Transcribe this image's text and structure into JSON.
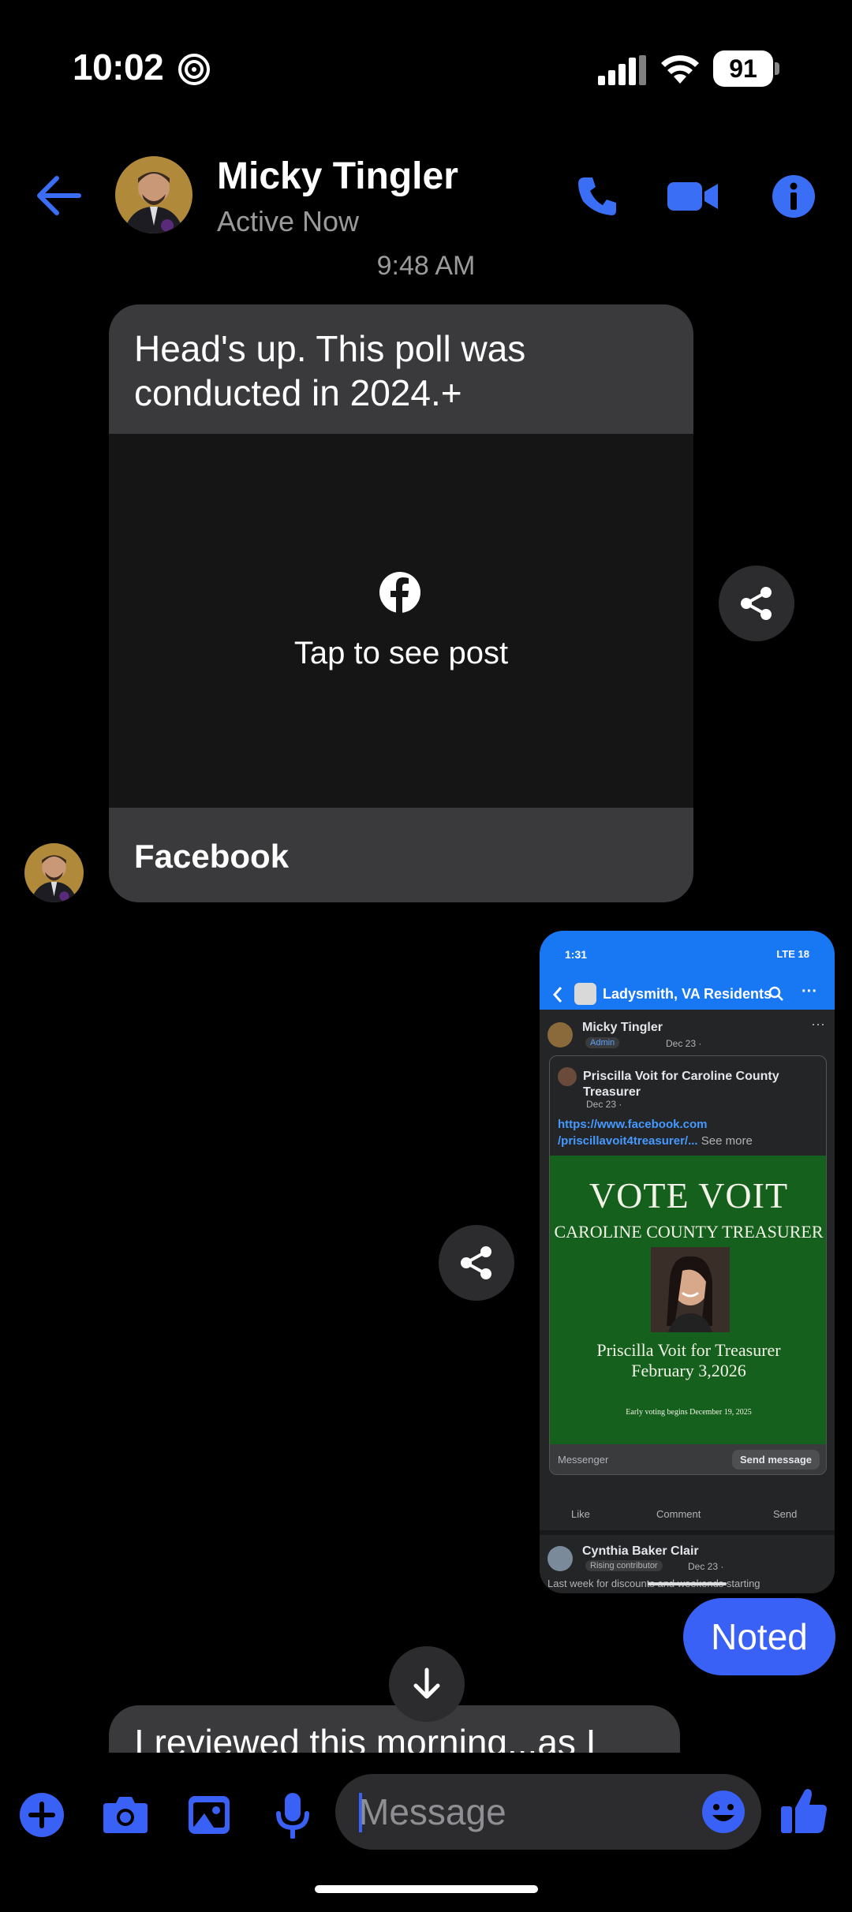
{
  "status_bar": {
    "time": "10:02",
    "battery": "91"
  },
  "header": {
    "contact_name": "Micky Tingler",
    "contact_status": "Active Now"
  },
  "conversation": {
    "timestamp": "9:48 AM",
    "shared_post": {
      "message": "Head's up.  This poll was conducted in 2024.+",
      "preview_label": "Tap to see post",
      "source": "Facebook"
    },
    "attachment": {
      "status_time": "1:31",
      "status_right": "LTE 18",
      "group_name": "Ladysmith, VA Residents",
      "poster_name": "Micky Tingler",
      "poster_badge": "Admin",
      "poster_date": "Dec 23 ·",
      "shared_page": "Priscilla Voit for Caroline County Treasurer",
      "shared_date": "Dec 23 ·",
      "link_line1": "https://www.facebook.com",
      "link_line2": "/priscillavoit4treasurer/...",
      "see_more": "See more",
      "flyer_title": "VOTE VOIT",
      "flyer_subtitle": "CAROLINE COUNTY TREASURER",
      "flyer_name": "Priscilla Voit for Treasurer",
      "flyer_date": "February 3,2026",
      "flyer_early": "Early voting begins December 19, 2025",
      "footer_label": "Messenger",
      "send_message": "Send message",
      "like": "Like",
      "comment": "Comment",
      "send": "Send",
      "commenter_name": "Cynthia Baker Clair",
      "commenter_badge": "Rising contributor",
      "commenter_date": "Dec 23 ·",
      "comment_preview": "Last week for discounts and weekends starting"
    },
    "sent_message": "Noted",
    "partial_message": "I reviewed this morning...as I"
  },
  "composer": {
    "placeholder": "Message"
  },
  "colors": {
    "accent": "#3a61f5",
    "link_blue": "#1877f2",
    "bubble_gray": "#3a3a3c",
    "background": "#000000"
  }
}
